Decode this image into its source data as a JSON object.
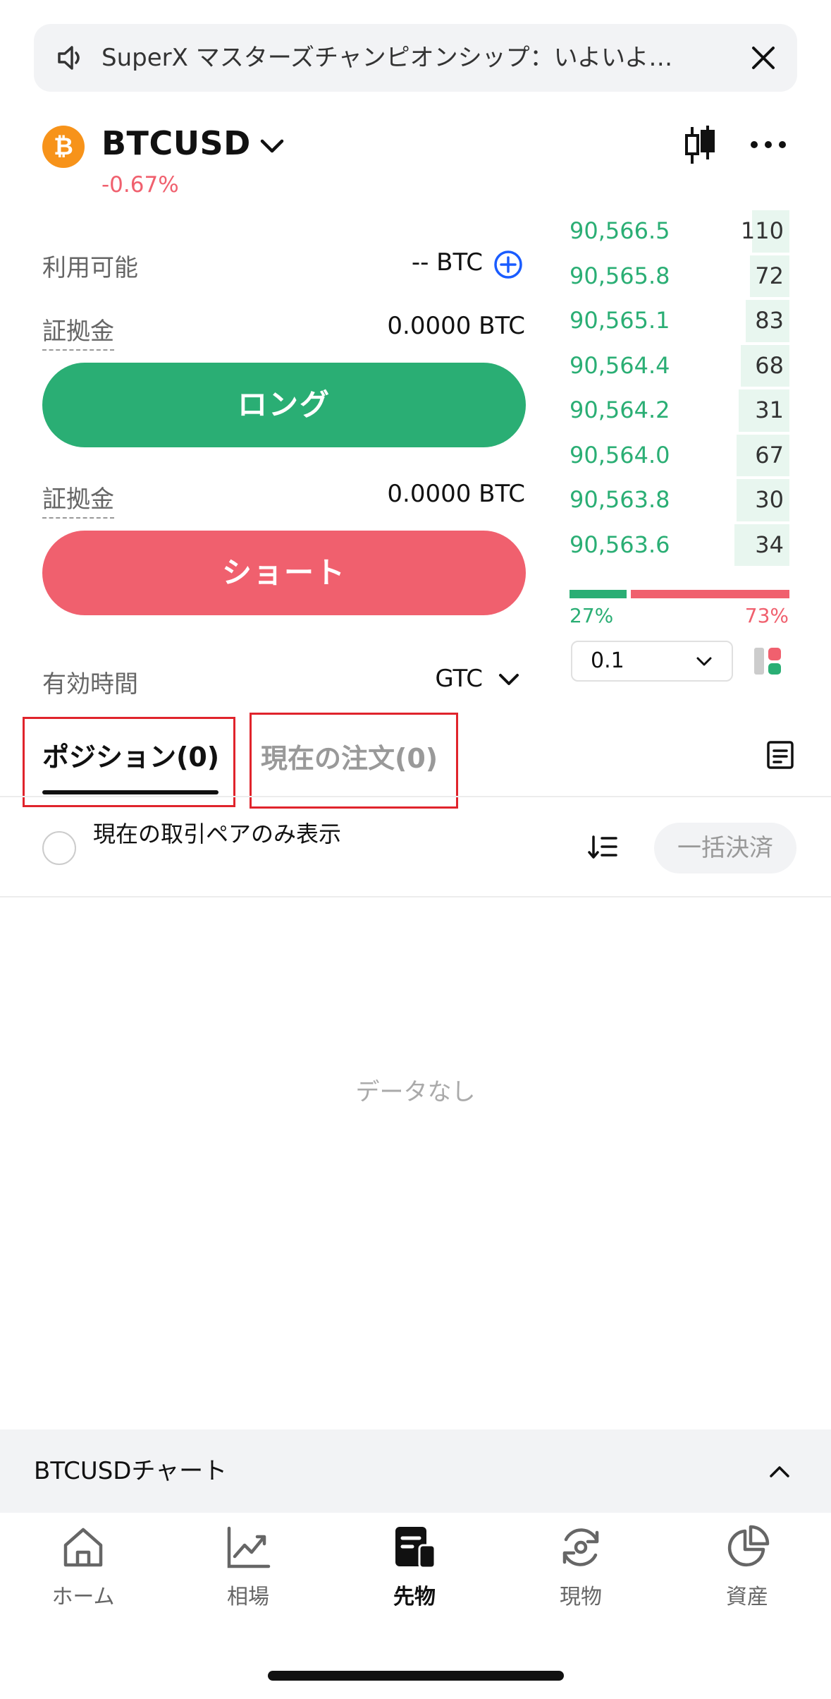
{
  "banner": {
    "text": "SuperX マスターズチャンピオンシップ：いよいよ…"
  },
  "header": {
    "coin_icon": "₿",
    "symbol": "BTCUSD",
    "change": "-0.67%"
  },
  "trade": {
    "available_label": "利用可能",
    "available_value": "-- BTC",
    "margin_label_1": "証拠金",
    "margin_value_1": "0.0000 BTC",
    "long_label": "ロング",
    "margin_label_2": "証拠金",
    "margin_value_2": "0.0000 BTC",
    "short_label": "ショート",
    "validity_label": "有効時間",
    "validity_value": "GTC"
  },
  "orderbook": {
    "rows": [
      {
        "price": "90,566.5",
        "qty": "110",
        "depth": 0.17
      },
      {
        "price": "90,565.8",
        "qty": "72",
        "depth": 0.18
      },
      {
        "price": "90,565.1",
        "qty": "83",
        "depth": 0.2
      },
      {
        "price": "90,564.4",
        "qty": "68",
        "depth": 0.22
      },
      {
        "price": "90,564.2",
        "qty": "31",
        "depth": 0.23
      },
      {
        "price": "90,564.0",
        "qty": "67",
        "depth": 0.24
      },
      {
        "price": "90,563.8",
        "qty": "30",
        "depth": 0.24
      },
      {
        "price": "90,563.6",
        "qty": "34",
        "depth": 0.25
      }
    ],
    "buy_pct": "27%",
    "sell_pct": "73%",
    "buy_ratio": 0.27,
    "depth_value": "0.1"
  },
  "tabs": {
    "positions": "ポジション(0)",
    "orders": "現在の注文(0)"
  },
  "filter": {
    "label": "現在の取引ペアのみ表示",
    "close_all": "一括決済"
  },
  "empty": {
    "text": "データなし"
  },
  "chart_bar": {
    "label": "BTCUSDチャート"
  },
  "nav": {
    "home": "ホーム",
    "market": "相場",
    "futures": "先物",
    "spot": "現物",
    "assets": "資産"
  },
  "colors": {
    "buy": "#2aae74",
    "sell": "#f0606e",
    "highlight": "#e0242c"
  }
}
